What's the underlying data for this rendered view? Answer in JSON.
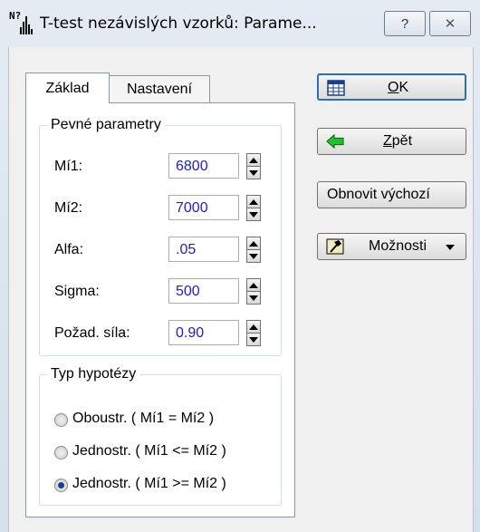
{
  "window": {
    "title": "T-test nezávislých vzorků: Parame...",
    "help_label": "?",
    "close_label": "✕",
    "app_icon_text": "N?"
  },
  "tabs": [
    {
      "label": "Základ",
      "active": true
    },
    {
      "label": "Nastavení",
      "active": false
    }
  ],
  "fixed_params": {
    "legend": "Pevné parametry",
    "fields": [
      {
        "label": "Mí1:",
        "value": "6800"
      },
      {
        "label": "Mí2:",
        "value": "7000"
      },
      {
        "label": "Alfa:",
        "value": ".05"
      },
      {
        "label": "Sigma:",
        "value": "500"
      },
      {
        "label": "Požad. síla:",
        "value": "0.90"
      }
    ]
  },
  "hypothesis": {
    "legend": "Typ hypotézy",
    "options": [
      {
        "label": "Oboustr. ( Mí1 = Mí2 )",
        "checked": false
      },
      {
        "label": "Jednostr. ( Mí1 <= Mí2 )",
        "checked": false
      },
      {
        "label": "Jednostr. ( Mí1 >= Mí2 )",
        "checked": true
      }
    ]
  },
  "buttons": {
    "ok_accel": "O",
    "ok_rest": "K",
    "back_accel": "Z",
    "back_rest": "pět",
    "reset_label": "Obnovit výchozí",
    "options_label": "Možnosti"
  },
  "colors": {
    "value_text": "#2020c8",
    "back_arrow": "#22c02a",
    "ok_border": "#2b6fb6"
  },
  "icons": {
    "ok": "table-grid-icon",
    "back": "green-left-arrow-icon",
    "options": "hammer-icon",
    "options_dropdown": "triangle-down-icon"
  }
}
